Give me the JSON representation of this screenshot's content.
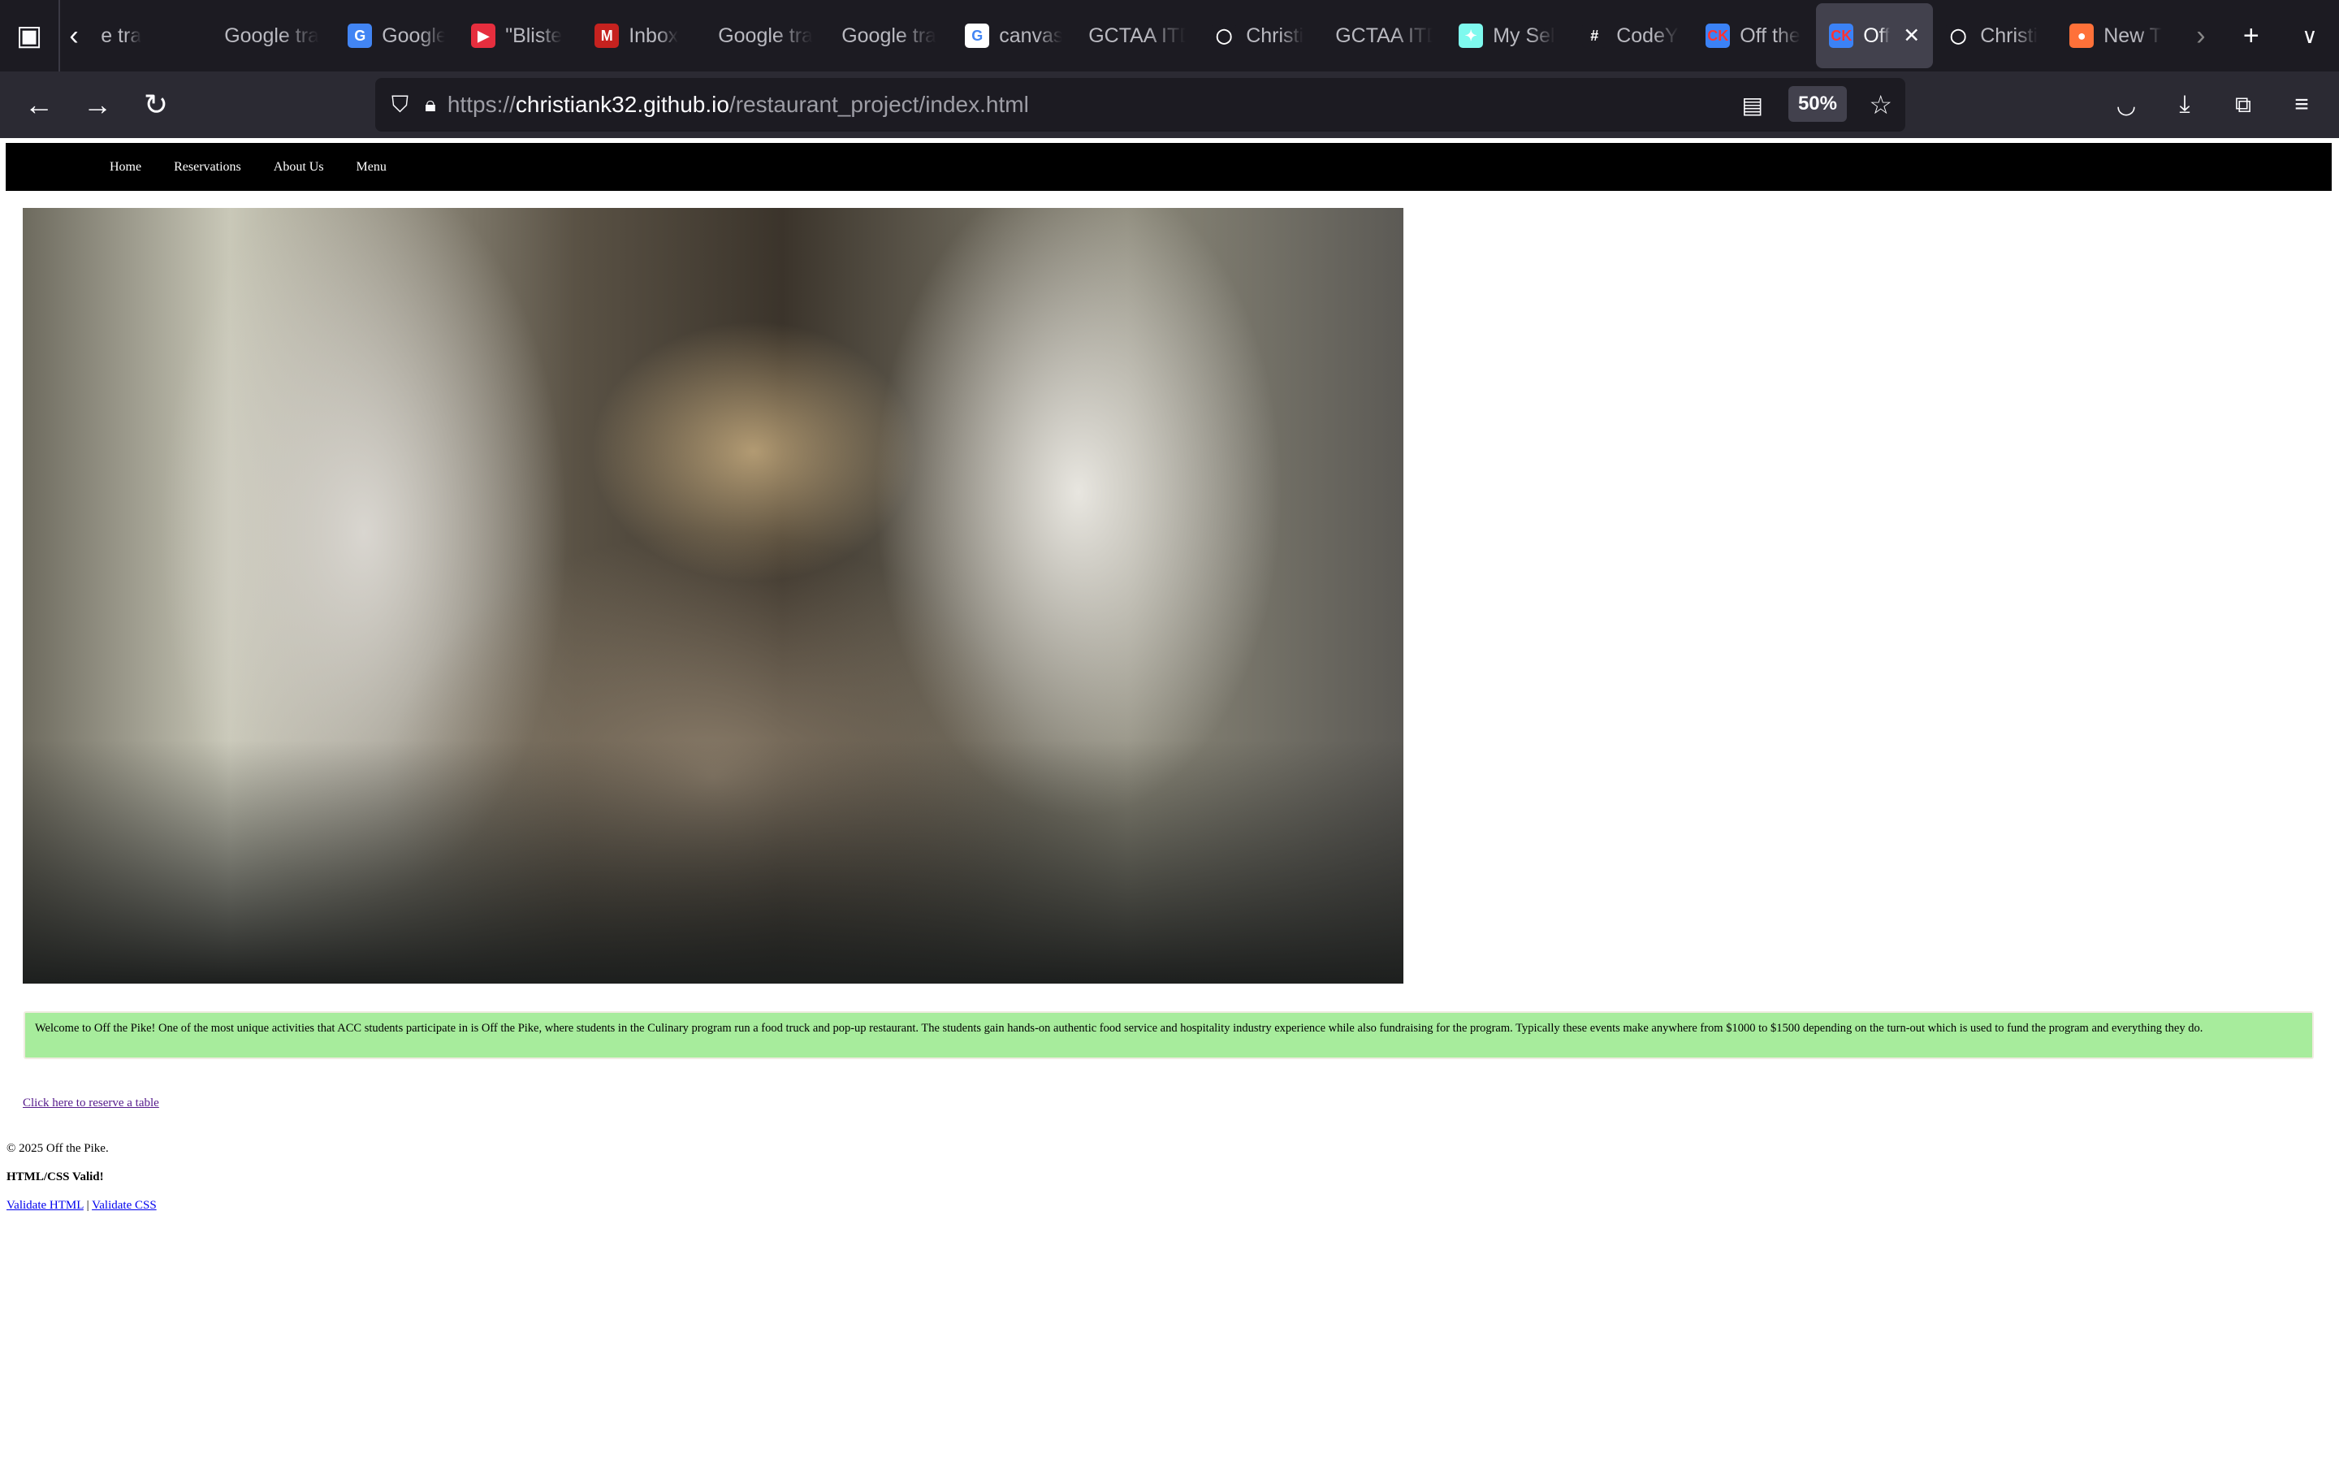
{
  "browser": {
    "tabs": [
      {
        "label": "e tra",
        "fav": "",
        "color": ""
      },
      {
        "label": "Google tra",
        "fav": "",
        "color": ""
      },
      {
        "label": "Google",
        "fav": "G",
        "color": "#4285f4"
      },
      {
        "label": "\"Bliste",
        "fav": "▶",
        "color": "#e62e3e"
      },
      {
        "label": "Inbox",
        "fav": "M",
        "color": "#c5221f"
      },
      {
        "label": "Google tra",
        "fav": "",
        "color": ""
      },
      {
        "label": "Google tra",
        "fav": "",
        "color": ""
      },
      {
        "label": "canvas",
        "fav": "G",
        "color": "#ffffff"
      },
      {
        "label": "GCTAA ITD",
        "fav": "",
        "color": ""
      },
      {
        "label": "Christi",
        "fav": "◯",
        "color": "#1c1b22"
      },
      {
        "label": "GCTAA ITD",
        "fav": "",
        "color": ""
      },
      {
        "label": "My Sel",
        "fav": "✦",
        "color": "#7ef9ee"
      },
      {
        "label": "CodeY",
        "fav": "#",
        "color": "#1c1b22"
      },
      {
        "label": "Off the",
        "fav": "CK",
        "color": "#3b82f6"
      },
      {
        "label": "Off",
        "fav": "CK",
        "color": "#3b82f6",
        "active": true
      },
      {
        "label": "Christi",
        "fav": "◯",
        "color": "#1c1b22"
      },
      {
        "label": "New T",
        "fav": "●",
        "color": "#ff7139"
      }
    ],
    "url_prefix": "https://",
    "url_host": "christiank32.github.io",
    "url_path": "/restaurant_project/index.html",
    "zoom": "50%"
  },
  "nav": {
    "items": [
      "Home",
      "Reservations",
      "About Us",
      "Menu"
    ]
  },
  "welcome": "Welcome to Off the Pike! One of the most unique activities that ACC students participate in is Off the Pike, where students in the Culinary program run a food truck and pop-up restaurant. The students gain hands-on authentic food service and hospitality industry experience while also fundraising for the program. Typically these events make anywhere from $1000 to $1500 depending on the turn-out which is used to fund the program and everything they do.",
  "reserve_link": "Click here to reserve a table",
  "footer": {
    "copyright": "© 2025 Off the Pike.",
    "valid": "HTML/CSS Valid!",
    "validate_html": "Validate HTML",
    "separator": " | ",
    "validate_css": "Validate CSS"
  },
  "colors": {
    "welcome_bg": "#a7ec9c",
    "nav_bg": "#000000"
  }
}
